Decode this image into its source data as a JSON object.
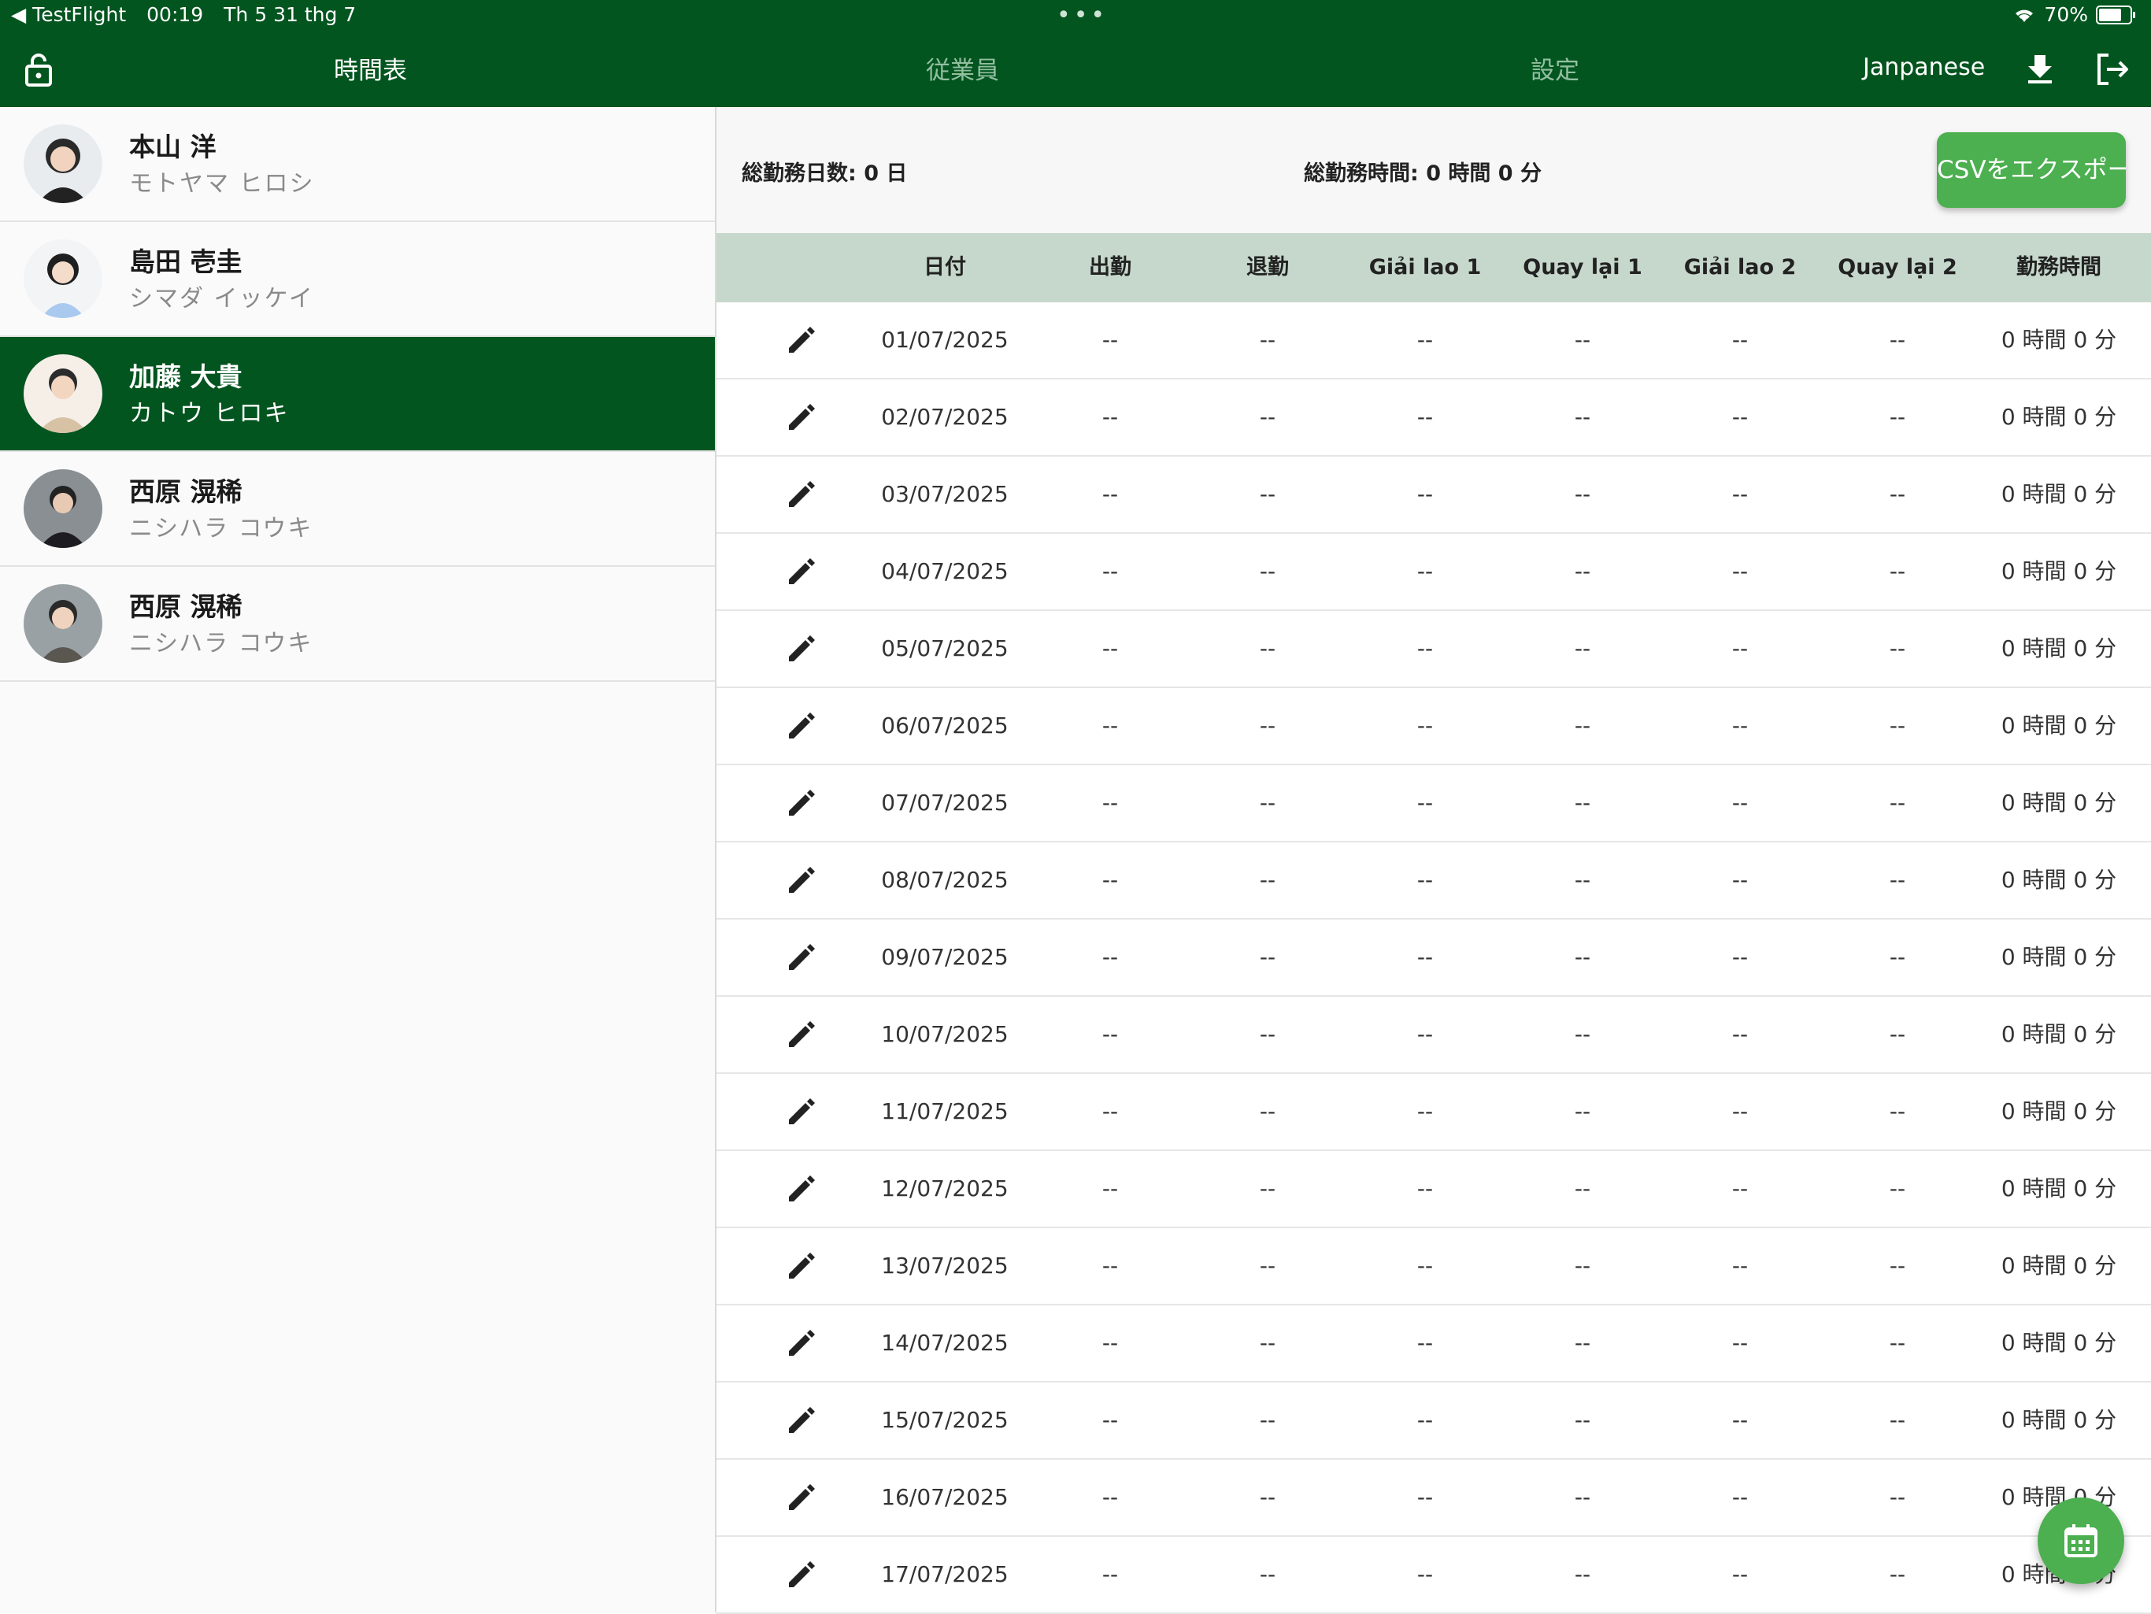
{
  "status_bar": {
    "back_app": "◀ TestFlight",
    "time": "00:19",
    "date": "Th 5 31 thg 7",
    "dots": "•••",
    "battery": "70%"
  },
  "nav": {
    "tabs": [
      {
        "label": "時間表",
        "active": true
      },
      {
        "label": "従業員",
        "active": false
      },
      {
        "label": "設定",
        "active": false
      }
    ],
    "language": "Janpanese"
  },
  "employees": [
    {
      "name": "本山 洋",
      "kana": "モトヤマ ヒロシ",
      "selected": false
    },
    {
      "name": "島田 壱圭",
      "kana": "シマダ イッケイ",
      "selected": false
    },
    {
      "name": "加藤 大貴",
      "kana": "カトウ ヒロキ",
      "selected": true
    },
    {
      "name": "西原 滉稀",
      "kana": "ニシハラ コウキ",
      "selected": false
    },
    {
      "name": "西原 滉稀",
      "kana": "ニシハラ コウキ",
      "selected": false
    }
  ],
  "summary": {
    "total_days": "総勤務日数: 0 日",
    "total_hours": "総勤務時間: 0 時間 0 分",
    "export_label": "CSVをエクスポート"
  },
  "table": {
    "headers": [
      "日付",
      "出勤",
      "退勤",
      "Giải lao 1",
      "Quay lại 1",
      "Giải lao 2",
      "Quay lại 2",
      "勤務時間"
    ],
    "rows": [
      {
        "date": "01/07/2025",
        "clock_in": "--",
        "clock_out": "--",
        "break1": "--",
        "return1": "--",
        "break2": "--",
        "return2": "--",
        "work_time": "0 時間 0 分"
      },
      {
        "date": "02/07/2025",
        "clock_in": "--",
        "clock_out": "--",
        "break1": "--",
        "return1": "--",
        "break2": "--",
        "return2": "--",
        "work_time": "0 時間 0 分"
      },
      {
        "date": "03/07/2025",
        "clock_in": "--",
        "clock_out": "--",
        "break1": "--",
        "return1": "--",
        "break2": "--",
        "return2": "--",
        "work_time": "0 時間 0 分"
      },
      {
        "date": "04/07/2025",
        "clock_in": "--",
        "clock_out": "--",
        "break1": "--",
        "return1": "--",
        "break2": "--",
        "return2": "--",
        "work_time": "0 時間 0 分"
      },
      {
        "date": "05/07/2025",
        "clock_in": "--",
        "clock_out": "--",
        "break1": "--",
        "return1": "--",
        "break2": "--",
        "return2": "--",
        "work_time": "0 時間 0 分"
      },
      {
        "date": "06/07/2025",
        "clock_in": "--",
        "clock_out": "--",
        "break1": "--",
        "return1": "--",
        "break2": "--",
        "return2": "--",
        "work_time": "0 時間 0 分"
      },
      {
        "date": "07/07/2025",
        "clock_in": "--",
        "clock_out": "--",
        "break1": "--",
        "return1": "--",
        "break2": "--",
        "return2": "--",
        "work_time": "0 時間 0 分"
      },
      {
        "date": "08/07/2025",
        "clock_in": "--",
        "clock_out": "--",
        "break1": "--",
        "return1": "--",
        "break2": "--",
        "return2": "--",
        "work_time": "0 時間 0 分"
      },
      {
        "date": "09/07/2025",
        "clock_in": "--",
        "clock_out": "--",
        "break1": "--",
        "return1": "--",
        "break2": "--",
        "return2": "--",
        "work_time": "0 時間 0 分"
      },
      {
        "date": "10/07/2025",
        "clock_in": "--",
        "clock_out": "--",
        "break1": "--",
        "return1": "--",
        "break2": "--",
        "return2": "--",
        "work_time": "0 時間 0 分"
      },
      {
        "date": "11/07/2025",
        "clock_in": "--",
        "clock_out": "--",
        "break1": "--",
        "return1": "--",
        "break2": "--",
        "return2": "--",
        "work_time": "0 時間 0 分"
      },
      {
        "date": "12/07/2025",
        "clock_in": "--",
        "clock_out": "--",
        "break1": "--",
        "return1": "--",
        "break2": "--",
        "return2": "--",
        "work_time": "0 時間 0 分"
      },
      {
        "date": "13/07/2025",
        "clock_in": "--",
        "clock_out": "--",
        "break1": "--",
        "return1": "--",
        "break2": "--",
        "return2": "--",
        "work_time": "0 時間 0 分"
      },
      {
        "date": "14/07/2025",
        "clock_in": "--",
        "clock_out": "--",
        "break1": "--",
        "return1": "--",
        "break2": "--",
        "return2": "--",
        "work_time": "0 時間 0 分"
      },
      {
        "date": "15/07/2025",
        "clock_in": "--",
        "clock_out": "--",
        "break1": "--",
        "return1": "--",
        "break2": "--",
        "return2": "--",
        "work_time": "0 時間 0 分"
      },
      {
        "date": "16/07/2025",
        "clock_in": "--",
        "clock_out": "--",
        "break1": "--",
        "return1": "--",
        "break2": "--",
        "return2": "--",
        "work_time": "0 時間 0 分"
      },
      {
        "date": "17/07/2025",
        "clock_in": "--",
        "clock_out": "--",
        "break1": "--",
        "return1": "--",
        "break2": "--",
        "return2": "--",
        "work_time": "0 時間 0 分"
      }
    ]
  },
  "icons": {
    "lock": "lock-icon",
    "download": "download-icon",
    "logout": "logout-icon",
    "edit": "pencil-icon",
    "calendar": "calendar-icon"
  },
  "colors": {
    "primary_dark": "#03551f",
    "accent": "#4caf50",
    "header_bg": "#c6d8cb"
  }
}
